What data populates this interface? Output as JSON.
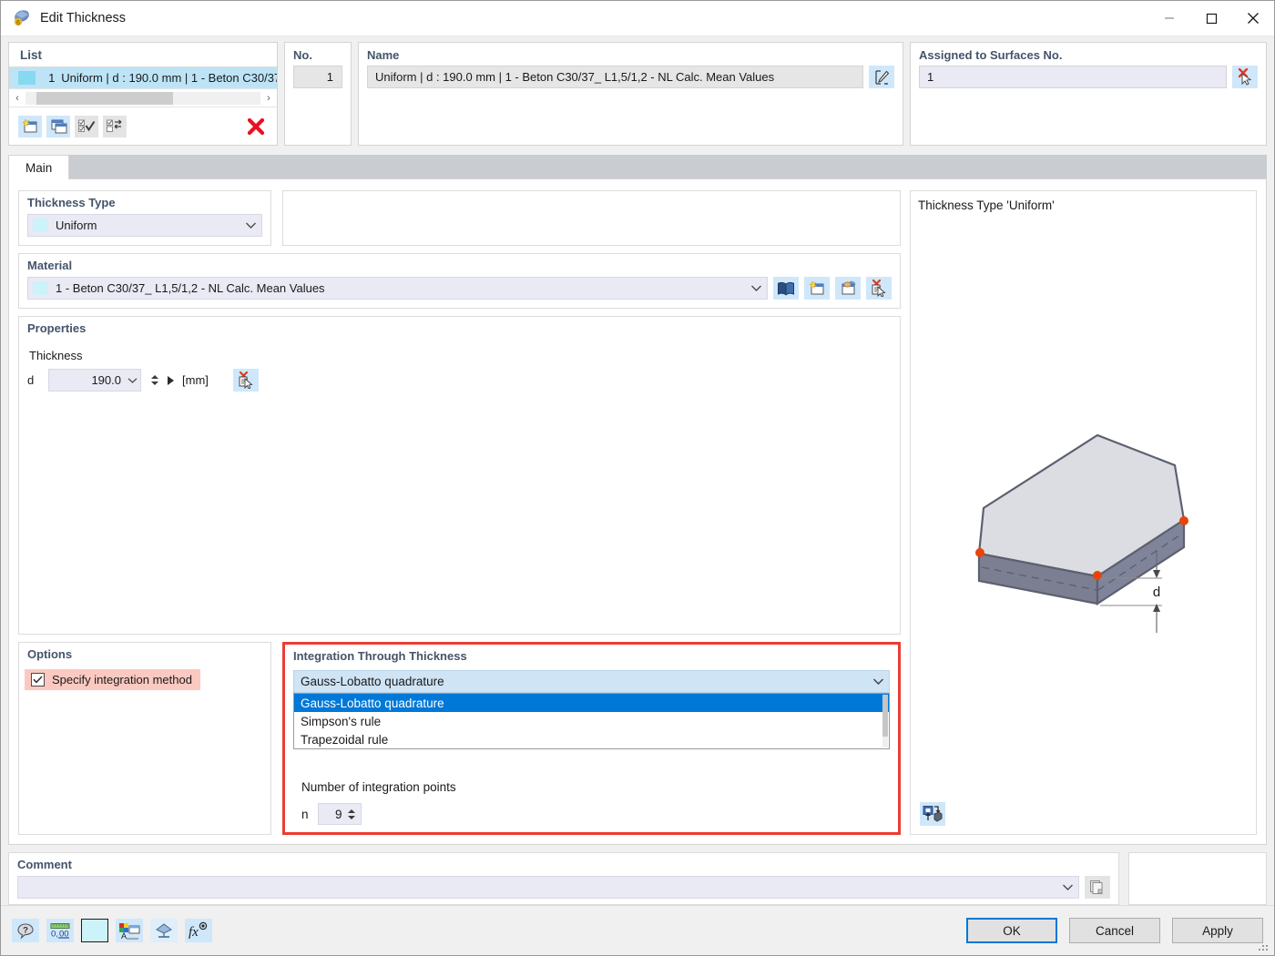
{
  "window": {
    "title": "Edit Thickness",
    "icon": "thickness-app-icon",
    "minimize": "minimize-icon",
    "maximize": "maximize-icon",
    "close": "close-icon"
  },
  "list": {
    "header": "List",
    "rows": [
      {
        "no": "1",
        "text": "Uniform | d : 190.0 mm | 1 - Beton C30/37",
        "selected": true
      }
    ],
    "tools": [
      {
        "name": "new-item-button",
        "icon": "new-window-star-icon",
        "enabled": true
      },
      {
        "name": "copy-item-button",
        "icon": "copy-windows-icon",
        "enabled": true
      },
      {
        "name": "select-all-button",
        "icon": "checkall-icon",
        "enabled": false
      },
      {
        "name": "invert-selection-button",
        "icon": "invert-check-icon",
        "enabled": false
      },
      {
        "name": "delete-item-button",
        "icon": "red-x-icon",
        "enabled": true
      }
    ],
    "scroll_left": "‹",
    "scroll_right": "›"
  },
  "no_panel": {
    "label": "No.",
    "value": "1"
  },
  "name_panel": {
    "label": "Name",
    "value": "Uniform | d : 190.0 mm | 1 - Beton C30/37_ L1,5/1,2 - NL Calc. Mean Values",
    "edit_button_icon": "rename-pencil-icon"
  },
  "assigned_panel": {
    "label": "Assigned to Surfaces No.",
    "value": "1",
    "pick_button_icon": "deselect-cursor-icon"
  },
  "tabs": [
    {
      "label": "Main",
      "active": true
    }
  ],
  "thickness_type": {
    "label": "Thickness Type",
    "value": "Uniform",
    "chevron": "chevron-down-icon"
  },
  "material": {
    "label": "Material",
    "value": "1 - Beton C30/37_ L1,5/1,2 - NL Calc. Mean Values",
    "buttons": [
      {
        "name": "material-library-button",
        "icon": "book-icon"
      },
      {
        "name": "new-material-button",
        "icon": "new-window-star-icon"
      },
      {
        "name": "edit-material-button",
        "icon": "edit-material-icon"
      },
      {
        "name": "pick-material-button",
        "icon": "pick-from-model-icon"
      }
    ]
  },
  "properties": {
    "title": "Properties",
    "thickness_label": "Thickness",
    "d_symbol": "d",
    "d_value": "190.0",
    "d_unit": "[mm]",
    "pick_button_icon": "pick-from-model-icon"
  },
  "options": {
    "title": "Options",
    "checkbox_label": "Specify integration method",
    "checked": true,
    "highlight_color": "#fbc9c1"
  },
  "integration": {
    "title": "Integration Through Thickness",
    "selected": "Gauss-Lobatto quadrature",
    "options": [
      "Gauss-Lobatto quadrature",
      "Simpson's rule",
      "Trapezoidal rule"
    ],
    "open": true,
    "border_color": "#ed3b34",
    "points_label": "Number of integration points",
    "n_symbol": "n",
    "n_value": "9"
  },
  "comment": {
    "title": "Comment",
    "value": "",
    "placeholder": "",
    "button_icon": "copy-pages-icon"
  },
  "preview": {
    "title": "Thickness Type  'Uniform'",
    "dimension_label": "d",
    "tool_icon": "toggle-render-icon",
    "slab_top_color": "#dcdde2",
    "slab_side_color": "#7b7f91",
    "node_color": "#e8430a"
  },
  "footer": {
    "tools": [
      {
        "name": "help-button",
        "icon": "help-balloon-icon"
      },
      {
        "name": "units-button",
        "icon": "decimal-ruler-icon"
      },
      {
        "name": "color-button",
        "icon": "color-swatch-icon"
      },
      {
        "name": "display-properties-button",
        "icon": "color-text-icon"
      },
      {
        "name": "view-button",
        "icon": "render-view-icon"
      },
      {
        "name": "formula-button",
        "icon": "fx-icon"
      }
    ],
    "ok": "OK",
    "cancel": "Cancel",
    "apply": "Apply"
  }
}
